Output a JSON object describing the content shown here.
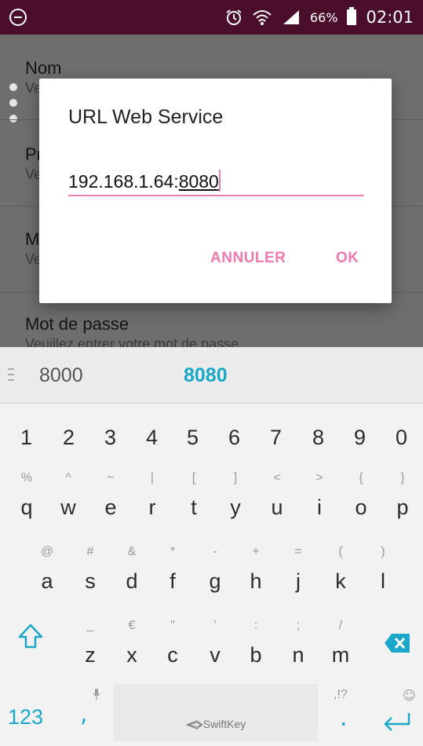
{
  "status_bar": {
    "battery": "66%",
    "time": "02:01",
    "icons": [
      "minus-circle-icon",
      "alarm-icon",
      "wifi-icon",
      "signal-icon",
      "battery-charging-icon"
    ]
  },
  "background_list": {
    "items": [
      {
        "title": "Nom",
        "subtitle": "Ve"
      },
      {
        "title": "Pr",
        "subtitle": "Ve"
      },
      {
        "title": "M",
        "subtitle": "Ve"
      },
      {
        "title": "Mot de passe",
        "subtitle": "Veuillez entrer votre mot de passe"
      }
    ]
  },
  "dialog": {
    "title": "URL Web Service",
    "input_value_prefix": "192.168.1.64:",
    "input_value_composing": "8080",
    "cancel_label": "ANNULER",
    "ok_label": "OK",
    "accent": "#f07aaf"
  },
  "suggestions": {
    "items": [
      "8000",
      "8080"
    ],
    "highlight_color": "#1aa7c8"
  },
  "keyboard": {
    "brand": "SwiftKey",
    "number_row": [
      "1",
      "2",
      "3",
      "4",
      "5",
      "6",
      "7",
      "8",
      "9",
      "0"
    ],
    "row1": [
      {
        "main": "q",
        "alt": "%"
      },
      {
        "main": "w",
        "alt": "^"
      },
      {
        "main": "e",
        "alt": "~"
      },
      {
        "main": "r",
        "alt": "|"
      },
      {
        "main": "t",
        "alt": "["
      },
      {
        "main": "y",
        "alt": "]"
      },
      {
        "main": "u",
        "alt": "<"
      },
      {
        "main": "i",
        "alt": ">"
      },
      {
        "main": "o",
        "alt": "{"
      },
      {
        "main": "p",
        "alt": "}"
      }
    ],
    "row2": [
      {
        "main": "a",
        "alt": "@"
      },
      {
        "main": "s",
        "alt": "#"
      },
      {
        "main": "d",
        "alt": "&"
      },
      {
        "main": "f",
        "alt": "*"
      },
      {
        "main": "g",
        "alt": "-"
      },
      {
        "main": "h",
        "alt": "+"
      },
      {
        "main": "j",
        "alt": "="
      },
      {
        "main": "k",
        "alt": "("
      },
      {
        "main": "l",
        "alt": ")"
      }
    ],
    "row3": [
      {
        "main": "z",
        "alt": "_"
      },
      {
        "main": "x",
        "alt": "€"
      },
      {
        "main": "c",
        "alt": "\""
      },
      {
        "main": "v",
        "alt": "'"
      },
      {
        "main": "b",
        "alt": ":"
      },
      {
        "main": "n",
        "alt": ";"
      },
      {
        "main": "m",
        "alt": "/"
      }
    ],
    "symbols_key": "123",
    "comma": ",",
    "period": ".",
    "punct_alt": ",!?",
    "smiley": "☺",
    "accent": "#1aa7c8"
  }
}
